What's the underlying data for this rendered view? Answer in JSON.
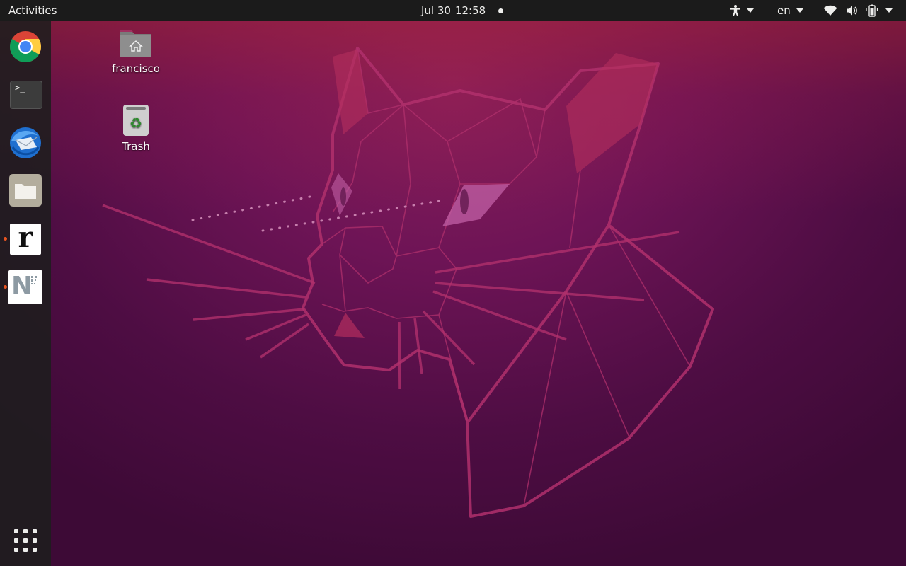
{
  "topbar": {
    "activities": "Activities",
    "date": "Jul 30",
    "time": "12:58",
    "language": "en"
  },
  "dock": {
    "items": [
      {
        "name": "Google Chrome",
        "icon": "chrome-icon"
      },
      {
        "name": "Terminal",
        "icon": "terminal-icon",
        "glyph": ">_"
      },
      {
        "name": "Thunderbird Mail",
        "icon": "thunderbird-icon"
      },
      {
        "name": "Files",
        "icon": "files-icon"
      },
      {
        "name": "r",
        "icon": "r-app-icon",
        "glyph": "r"
      },
      {
        "name": "N",
        "icon": "n-app-icon",
        "glyph": "N"
      }
    ],
    "show_apps_icon": "app-grid-icon"
  },
  "desktop": {
    "icons": [
      {
        "label": "francisco",
        "icon": "home-folder-icon"
      },
      {
        "label": "Trash",
        "icon": "trash-icon"
      }
    ]
  },
  "colors": {
    "accent": "#e95420",
    "topbar": "#1b1b1b",
    "dock": "#1e1e1e"
  }
}
